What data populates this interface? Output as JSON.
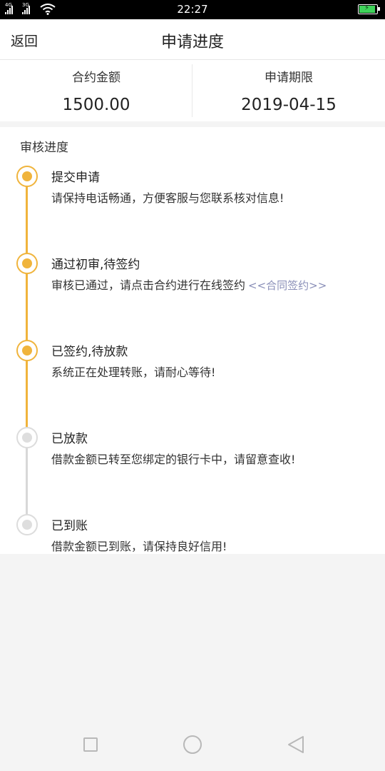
{
  "status_bar": {
    "time": "22:27",
    "signal_1_label": "4G",
    "signal_2_label": "3G",
    "icons": [
      "signal-icon",
      "wifi-icon",
      "battery-charging-icon"
    ]
  },
  "header": {
    "back_label": "返回",
    "title": "申请进度"
  },
  "summary": {
    "amount_label": "合约金额",
    "amount_value": "1500.00",
    "date_label": "申请期限",
    "date_value": "2019-04-15"
  },
  "progress": {
    "section_title": "审核进度",
    "steps": [
      {
        "title": "提交申请",
        "desc": "请保持电话畅通，方便客服与您联系核对信息!",
        "done": true
      },
      {
        "title": "通过初审,待签约",
        "desc": "审核已通过，请点击合约进行在线签约",
        "link": "<<合同签约>>",
        "done": true
      },
      {
        "title": "已签约,待放款",
        "desc": "系统正在处理转账，请耐心等待!",
        "done": true
      },
      {
        "title": "已放款",
        "desc": "借款金额已转至您绑定的银行卡中，请留意查收!",
        "done": false
      },
      {
        "title": "已到账",
        "desc": "借款金额已到账，请保持良好信用!",
        "done": false
      }
    ]
  },
  "colors": {
    "done": "#f0b43c",
    "todo": "#d8d8d8",
    "link": "#8a8fb8"
  },
  "nav_bar": {
    "icons": [
      "recent-apps-icon",
      "home-icon",
      "back-triangle-icon"
    ]
  }
}
